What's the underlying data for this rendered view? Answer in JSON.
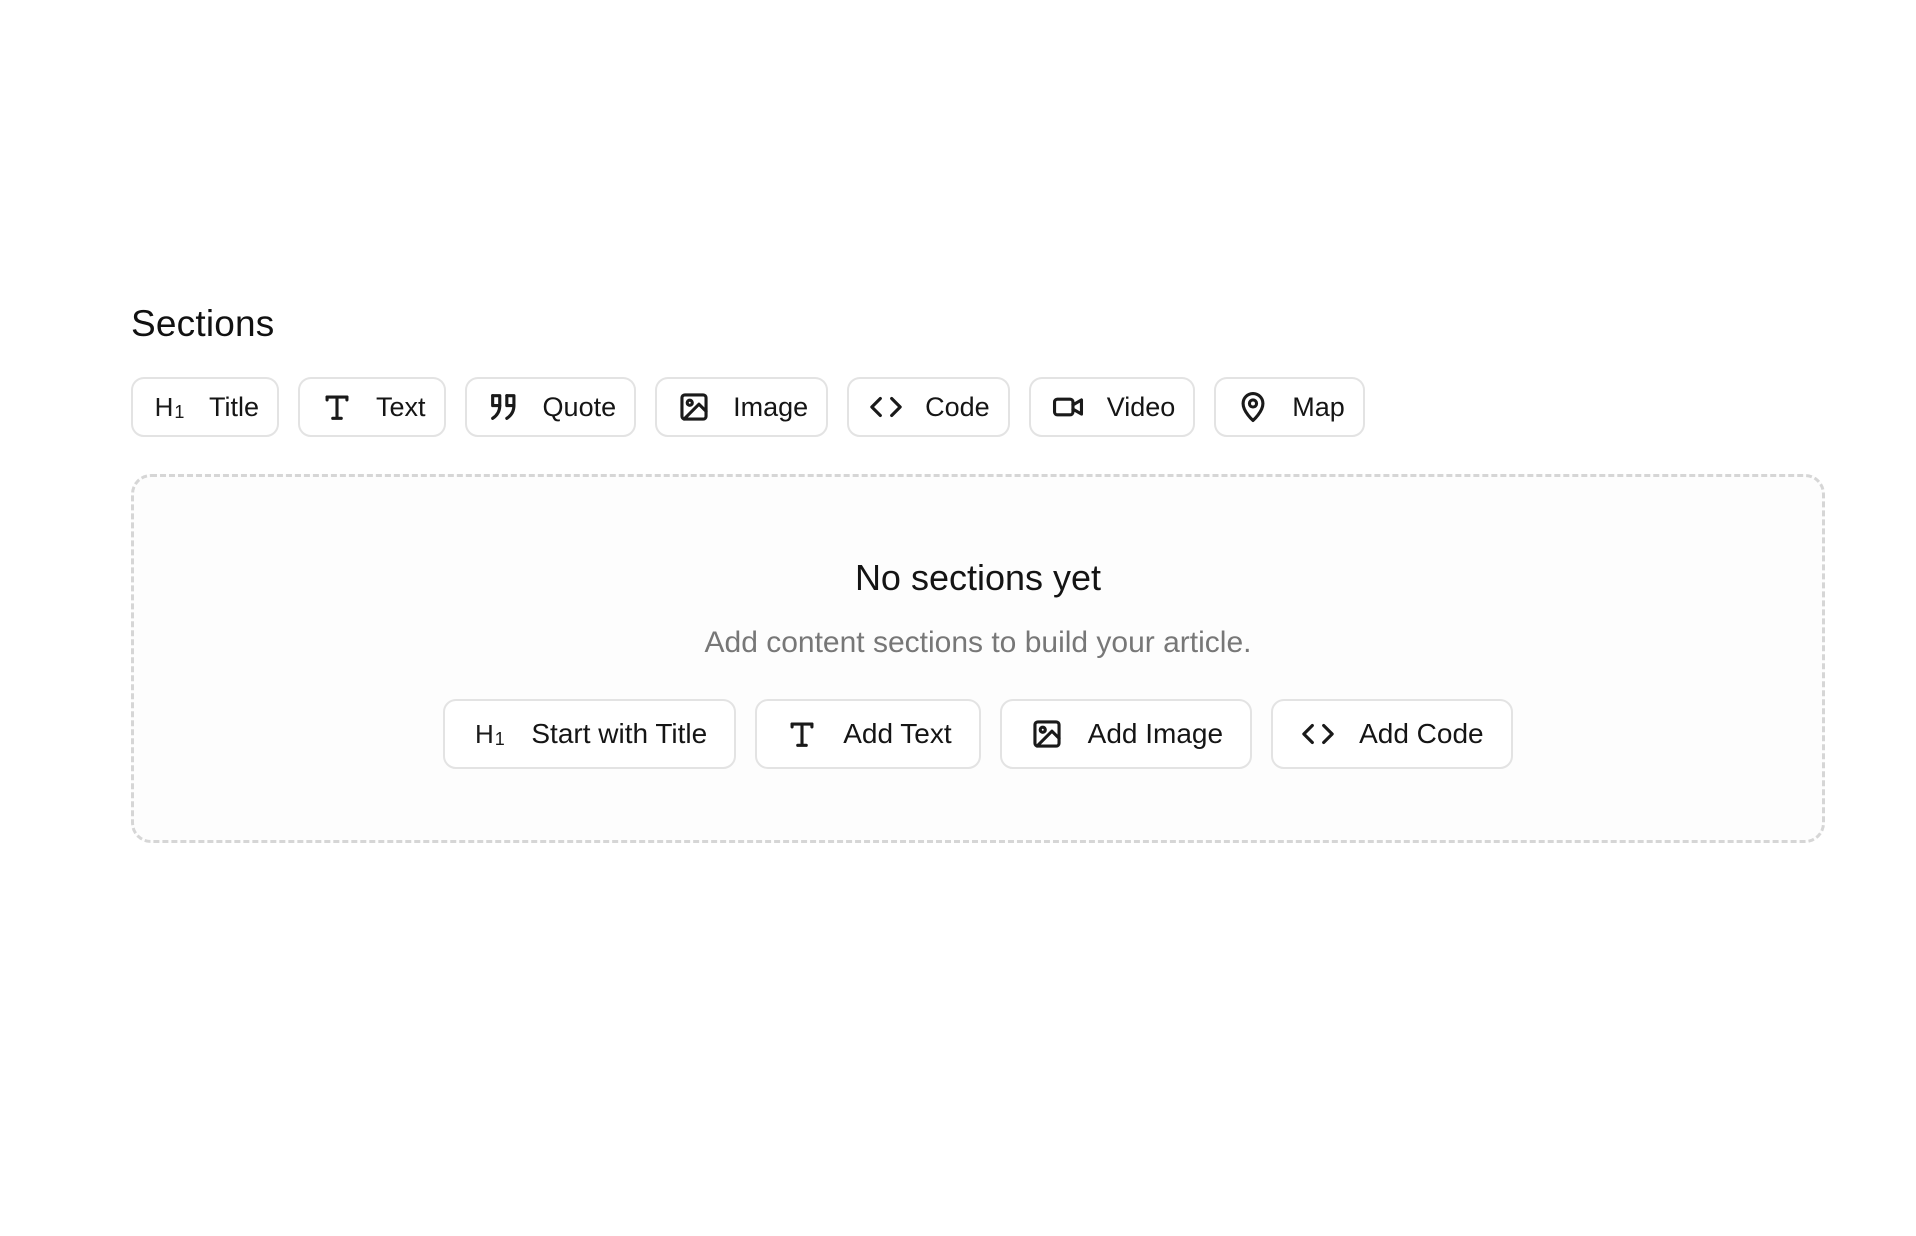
{
  "sections": {
    "heading": "Sections",
    "toolbar": [
      {
        "label": "Title",
        "icon": "heading-1-icon"
      },
      {
        "label": "Text",
        "icon": "type-icon"
      },
      {
        "label": "Quote",
        "icon": "quote-icon"
      },
      {
        "label": "Image",
        "icon": "image-icon"
      },
      {
        "label": "Code",
        "icon": "code-icon"
      },
      {
        "label": "Video",
        "icon": "video-icon"
      },
      {
        "label": "Map",
        "icon": "map-pin-icon"
      }
    ],
    "empty_state": {
      "title": "No sections yet",
      "subtitle": "Add content sections to build your article.",
      "actions": [
        {
          "label": "Start with Title",
          "icon": "heading-1-icon"
        },
        {
          "label": "Add Text",
          "icon": "type-icon"
        },
        {
          "label": "Add Image",
          "icon": "image-icon"
        },
        {
          "label": "Add Code",
          "icon": "code-icon"
        }
      ]
    }
  },
  "colors": {
    "text": "#141414",
    "muted_text": "#777777",
    "border": "#e3e3e3",
    "dashed_border": "#d6d6d6"
  }
}
